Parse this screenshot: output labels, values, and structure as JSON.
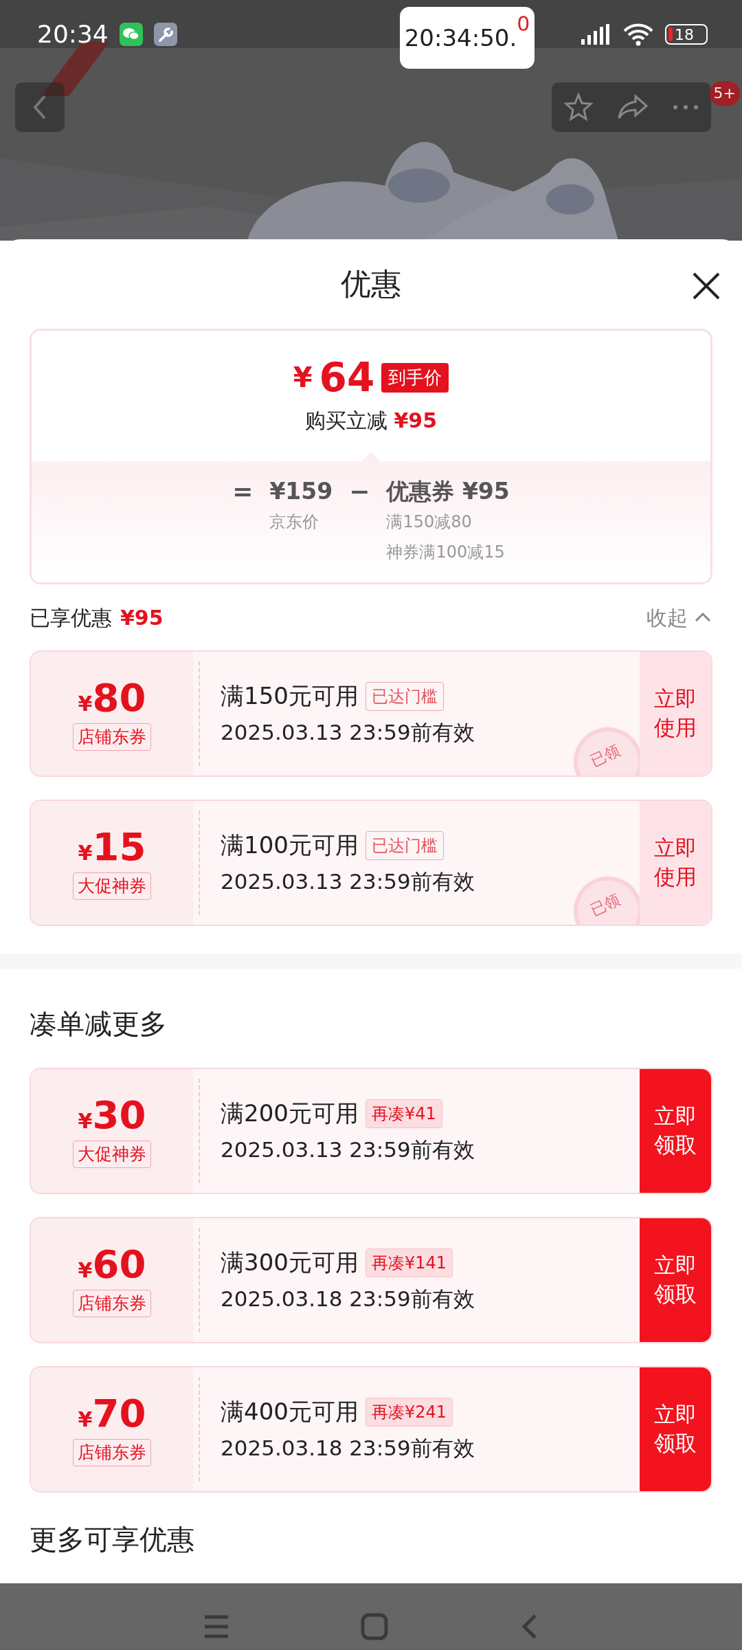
{
  "status_bar": {
    "time": "20:34",
    "battery": "18"
  },
  "floating_clock": {
    "time": "20:34:50.",
    "digit": "0"
  },
  "top_bar": {
    "badge": "5+"
  },
  "sheet": {
    "title": "优惠"
  },
  "price_summary": {
    "currency": "¥",
    "price": "64",
    "price_tag": "到手价",
    "discount_label": "购买立减",
    "discount": "¥95",
    "equals": "=",
    "original_price": "¥159",
    "original_label": "京东价",
    "minus": "−",
    "coupon_label": "优惠券",
    "coupon_amount": "¥95",
    "coupon_details": [
      "满150减80",
      "神券满100减15"
    ]
  },
  "enjoyed": {
    "label": "已享优惠",
    "amount": "¥95",
    "toggle": "收起",
    "expanded": true
  },
  "enjoyed_coupons": [
    {
      "kind": "claimed",
      "currency": "¥",
      "amount": "80",
      "type": "店铺东券",
      "condition": "满150元可用",
      "tag": "已达门槛",
      "validity": "2025.03.13 23:59前有效",
      "action": "立即使用",
      "stamp": "已领"
    },
    {
      "kind": "claimed",
      "currency": "¥",
      "amount": "15",
      "type": "大促神券",
      "condition": "满100元可用",
      "tag": "已达门槛",
      "validity": "2025.03.13 23:59前有效",
      "action": "立即使用",
      "stamp": "已领"
    }
  ],
  "more_section": {
    "title": "凑单减更多"
  },
  "more_coupons": [
    {
      "kind": "available",
      "currency": "¥",
      "amount": "30",
      "type": "大促神券",
      "condition": "满200元可用",
      "tag": "再凑¥41",
      "validity": "2025.03.13 23:59前有效",
      "action": "立即领取"
    },
    {
      "kind": "available",
      "currency": "¥",
      "amount": "60",
      "type": "店铺东券",
      "condition": "满300元可用",
      "tag": "再凑¥141",
      "validity": "2025.03.18 23:59前有效",
      "action": "立即领取"
    },
    {
      "kind": "available",
      "currency": "¥",
      "amount": "70",
      "type": "店铺东券",
      "condition": "满400元可用",
      "tag": "再凑¥241",
      "validity": "2025.03.18 23:59前有效",
      "action": "立即领取"
    }
  ],
  "extra_section": {
    "title": "更多可享优惠"
  }
}
